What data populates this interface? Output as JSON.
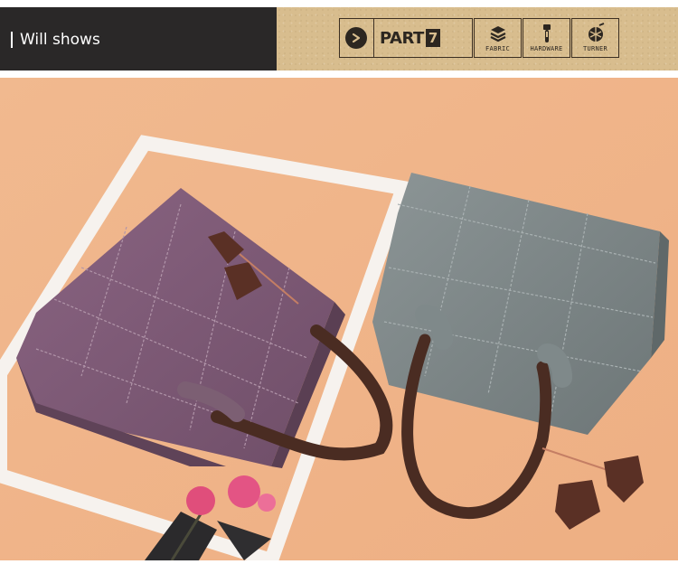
{
  "header": {
    "title": "Will shows",
    "part_label": "PART",
    "part_number": "7",
    "icons": [
      {
        "name": "fabric-icon",
        "label": "FABRIC"
      },
      {
        "name": "hardware-icon",
        "label": "HARDWARE"
      },
      {
        "name": "turner-icon",
        "label": "TURNER"
      }
    ]
  },
  "colors": {
    "header_dark": "#2a2828",
    "header_tan": "#d8bd8e",
    "backdrop": "#efb48a",
    "purple_bag": "#7e5a75",
    "gray_bag": "#7a8485",
    "handle": "#4a2c22"
  }
}
